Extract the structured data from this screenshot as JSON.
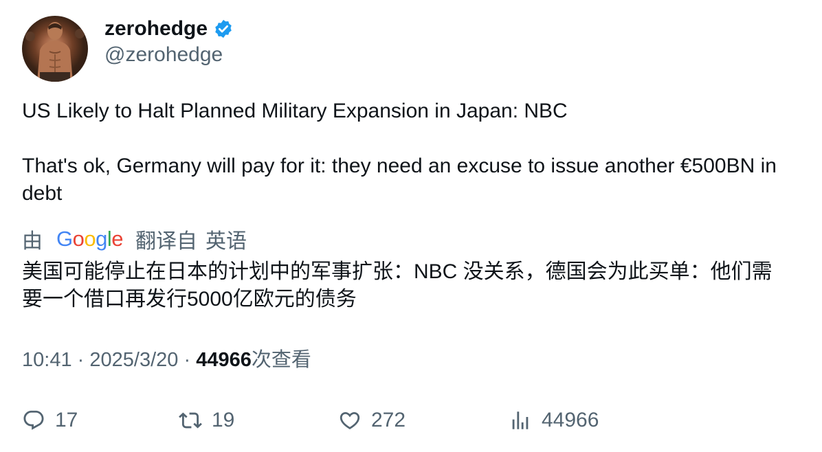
{
  "user": {
    "display_name": "zerohedge",
    "handle": "@zerohedge",
    "verified": true,
    "verified_color": "#1d9bf0"
  },
  "tweet": {
    "line1": "US Likely to Halt Planned Military Expansion in Japan: NBC",
    "line2": "That's ok, Germany will pay for it: they need an excuse to issue another €500BN in debt"
  },
  "translation": {
    "by_label": "由",
    "provider_letters": [
      "G",
      "o",
      "o",
      "g",
      "l",
      "e"
    ],
    "translated_from_label": "翻译自",
    "source_language": "英语",
    "text": "美国可能停止在日本的计划中的军事扩张：NBC 没关系，德国会为此买单：他们需要一个借口再发行5000亿欧元的债务"
  },
  "meta": {
    "time": "10:41",
    "separator": "·",
    "date": "2025/3/20",
    "views_count": "44966",
    "views_label": "次查看"
  },
  "actions": {
    "reply_count": "17",
    "retweet_count": "19",
    "like_count": "272",
    "views_count": "44966"
  },
  "colors": {
    "text_primary": "#0f1419",
    "text_secondary": "#536471",
    "google_blue": "#4285F4",
    "google_red": "#EA4335",
    "google_yellow": "#FBBC05",
    "google_green": "#34A853"
  },
  "icons": {
    "reply": "reply-icon",
    "retweet": "retweet-icon",
    "like": "like-icon",
    "views": "views-icon",
    "verified": "verified-badge-icon"
  }
}
